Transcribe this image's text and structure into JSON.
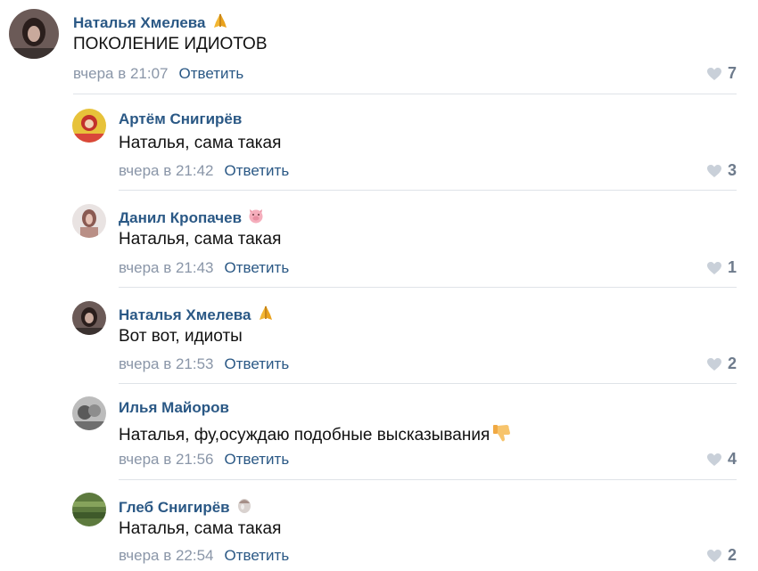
{
  "comments": [
    {
      "author": "Наталья Хмелева",
      "author_emoji": "folded-hands",
      "text": "ПОКОЛЕНИЕ ИДИОТОВ",
      "time": "вчера в 21:07",
      "reply_label": "Ответить",
      "likes": "7"
    },
    {
      "author": "Артём Снигирёв",
      "text": "Наталья, сама такая",
      "time": "вчера в 21:42",
      "reply_label": "Ответить",
      "likes": "3"
    },
    {
      "author": "Данил Кропачев",
      "author_emoji": "pig-face",
      "text": "Наталья, сама такая",
      "time": "вчера в 21:43",
      "reply_label": "Ответить",
      "likes": "1"
    },
    {
      "author": "Наталья Хмелева",
      "author_emoji": "folded-hands",
      "text": "Вот вот, идиоты",
      "time": "вчера в 21:53",
      "reply_label": "Ответить",
      "likes": "2"
    },
    {
      "author": "Илья Майоров",
      "text": "Наталья, фу,осуждаю подобные высказывания",
      "text_emoji": "thumbs-down",
      "time": "вчера в 21:56",
      "reply_label": "Ответить",
      "likes": "4"
    },
    {
      "author": "Глеб Снигирёв",
      "author_emoji": "nut",
      "text": "Наталья, сама такая",
      "time": "вчера в 22:54",
      "reply_label": "Ответить",
      "likes": "2"
    }
  ],
  "colors": {
    "author_link": "#2a5885",
    "meta_gray": "#8a96a8",
    "like_gray": "#6e7b8c",
    "divider": "#dfe3e8"
  }
}
